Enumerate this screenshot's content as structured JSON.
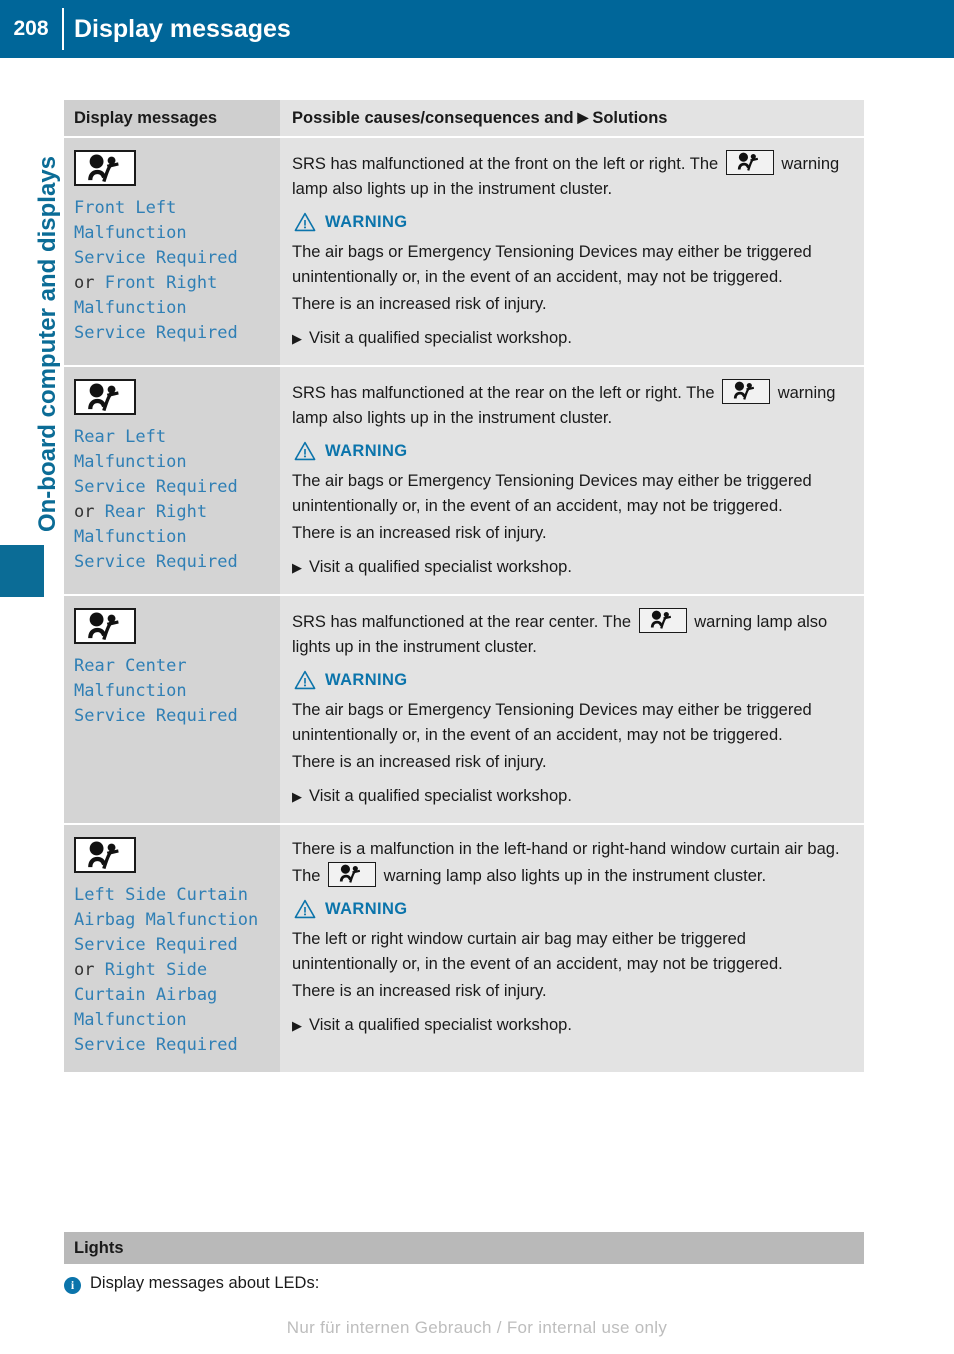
{
  "header": {
    "page_number": "208",
    "title": "Display messages"
  },
  "sidebar": {
    "chapter_label": "On-board computer and displays"
  },
  "table": {
    "col1_header": "Display messages",
    "col2_header_before": "Possible causes/consequences and",
    "col2_header_arrow": "▶",
    "col2_header_after": "Solutions",
    "rows": [
      {
        "icon": "airbag-warning-icon",
        "message_lines": [
          {
            "text": "Front Left",
            "style": "code"
          },
          {
            "text": "Malfunction",
            "style": "code"
          },
          {
            "text": "Service Required",
            "style": "code"
          },
          {
            "text": "or ",
            "style": "plain",
            "code_after": "Front Right"
          },
          {
            "text": "Malfunction",
            "style": "code"
          },
          {
            "text": "Service Required",
            "style": "code"
          }
        ],
        "intro_before": "SRS has malfunctioned at the front on the left or right. The",
        "intro_after": "warning lamp also lights up in the instrument cluster.",
        "warning_label": "WARNING",
        "warning_body": [
          "The air bags or Emergency Tensioning Devices may either be triggered unintentionally or, in the event of an accident, may not be triggered.",
          "There is an increased risk of injury."
        ],
        "action": "Visit a qualified specialist workshop."
      },
      {
        "icon": "airbag-warning-icon",
        "message_lines": [
          {
            "text": "Rear Left",
            "style": "code"
          },
          {
            "text": "Malfunction",
            "style": "code"
          },
          {
            "text": "Service Required",
            "style": "code"
          },
          {
            "text": "or ",
            "style": "plain",
            "code_after": "Rear Right"
          },
          {
            "text": "Malfunction",
            "style": "code"
          },
          {
            "text": "Service Required",
            "style": "code"
          }
        ],
        "intro_before": "SRS has malfunctioned at the rear on the left or right. The",
        "intro_after": "warning lamp also lights up in the instrument cluster.",
        "warning_label": "WARNING",
        "warning_body": [
          "The air bags or Emergency Tensioning Devices may either be triggered unintentionally or, in the event of an accident, may not be triggered.",
          "There is an increased risk of injury."
        ],
        "action": "Visit a qualified specialist workshop."
      },
      {
        "icon": "airbag-warning-icon",
        "message_lines": [
          {
            "text": "Rear Center",
            "style": "code"
          },
          {
            "text": "Malfunction",
            "style": "code"
          },
          {
            "text": "Service Required",
            "style": "code"
          }
        ],
        "intro_before": "SRS has malfunctioned at the rear center. The",
        "intro_after": "warning lamp also lights up in the instrument cluster.",
        "warning_label": "WARNING",
        "warning_body": [
          "The air bags or Emergency Tensioning Devices may either be triggered unintentionally or, in the event of an accident, may not be triggered.",
          "There is an increased risk of injury."
        ],
        "action": "Visit a qualified specialist workshop."
      },
      {
        "icon": "airbag-warning-icon",
        "message_lines": [
          {
            "text": "Left Side Curtain",
            "style": "code"
          },
          {
            "text": "Airbag Malfunction",
            "style": "code"
          },
          {
            "text": "Service Required",
            "style": "code"
          },
          {
            "text": "or ",
            "style": "plain",
            "code_after": "Right Side"
          },
          {
            "text": "Curtain Airbag",
            "style": "code"
          },
          {
            "text": "Malfunction",
            "style": "code"
          },
          {
            "text": "Service Required",
            "style": "code"
          }
        ],
        "intro_before": "There is a malfunction in the left-hand or right-hand window curtain air bag. The",
        "intro_after": "warning lamp also lights up in the instrument cluster.",
        "warning_label": "WARNING",
        "warning_body": [
          "The left or right window curtain air bag may either be triggered unintentionally or, in the event of an accident, may not be triggered.",
          "There is an increased risk of injury."
        ],
        "action": "Visit a qualified specialist workshop."
      }
    ]
  },
  "lights_section": {
    "heading": "Lights",
    "note_icon": "info-icon",
    "note_text": "Display messages about LEDs:"
  },
  "footer": {
    "watermark": "Nur für internen Gebrauch / For internal use only"
  },
  "colors": {
    "header_blue": "#006699",
    "accent_blue": "#0b74ab",
    "code_blue": "#2f7fb5",
    "header_row_left": "#cfcfcf",
    "header_row_right": "#e3e3e3",
    "cell_left": "#d4d4d4",
    "cell_right": "#e3e3e3",
    "lights_bar": "#b9b9b9"
  }
}
